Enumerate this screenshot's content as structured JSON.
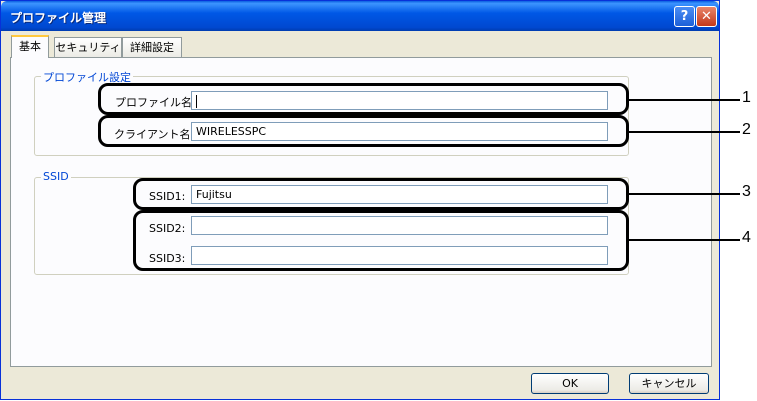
{
  "window": {
    "title": "プロファイル管理",
    "help_label": "?",
    "close_label": "✕"
  },
  "tabs": [
    {
      "label": "基本",
      "active": true
    },
    {
      "label": "セキュリティ",
      "active": false
    },
    {
      "label": "詳細設定",
      "active": false
    }
  ],
  "profile_group": {
    "legend": "プロファイル設定",
    "profile_name": {
      "label": "プロファイル名:",
      "value": ""
    },
    "client_name": {
      "label": "クライアント名:",
      "value": "WIRELESSPC"
    }
  },
  "ssid_group": {
    "legend": "SSID",
    "ssid1": {
      "label": "SSID1:",
      "value": "Fujitsu"
    },
    "ssid2": {
      "label": "SSID2:",
      "value": ""
    },
    "ssid3": {
      "label": "SSID3:",
      "value": ""
    }
  },
  "callouts": [
    "1",
    "2",
    "3",
    "4"
  ],
  "buttons": {
    "ok": "OK",
    "cancel": "キャンセル"
  }
}
